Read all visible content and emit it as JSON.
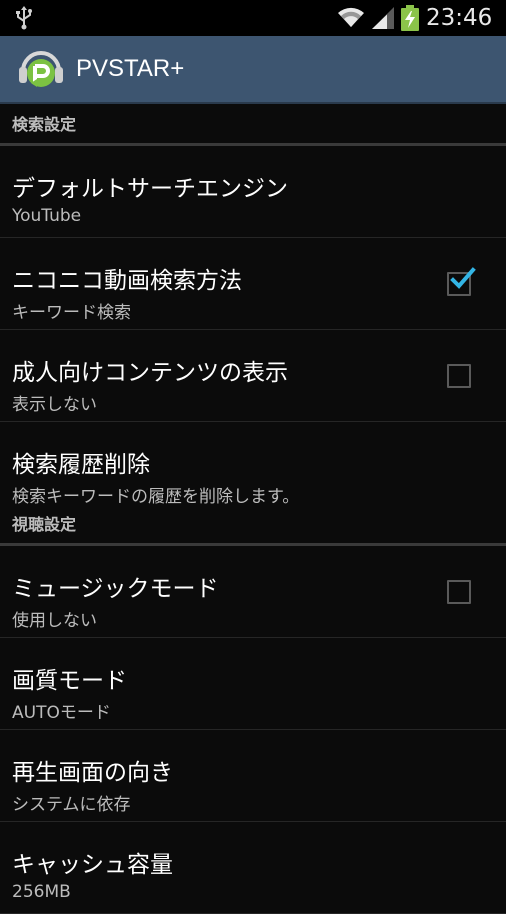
{
  "status_bar": {
    "time": "23:46",
    "icons": [
      "usb-icon",
      "wifi-icon",
      "signal-icon",
      "battery-charging-icon"
    ]
  },
  "action_bar": {
    "title": "PVSTAR+",
    "logo_icon": "pvstar-headphones-logo"
  },
  "colors": {
    "action_bar": "#3d5570",
    "check_accent": "#33b5e5",
    "battery": "#8bc34a"
  },
  "sections": [
    {
      "header": "検索設定",
      "items": [
        {
          "title": "デフォルトサーチエンジン",
          "summary": "YouTube"
        },
        {
          "title": "ニコニコ動画検索方法",
          "summary": "キーワード検索",
          "checked": true
        },
        {
          "title": "成人向けコンテンツの表示",
          "summary": "表示しない",
          "checked": false
        },
        {
          "title": "検索履歴削除",
          "summary": "検索キーワードの履歴を削除します。"
        }
      ]
    },
    {
      "header": "視聴設定",
      "items": [
        {
          "title": "ミュージックモード",
          "summary": "使用しない",
          "checked": false
        },
        {
          "title": "画質モード",
          "summary": "AUTOモード"
        },
        {
          "title": "再生画面の向き",
          "summary": "システムに依存"
        },
        {
          "title": "キャッシュ容量",
          "summary": "256MB"
        }
      ]
    }
  ]
}
